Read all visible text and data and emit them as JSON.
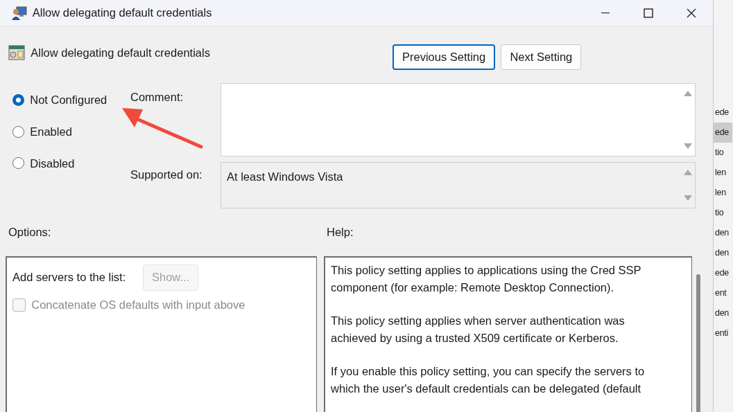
{
  "window": {
    "title": "Allow delegating default credentials"
  },
  "setting": {
    "name": "Allow delegating default credentials"
  },
  "nav_buttons": [
    {
      "label": "Previous Setting",
      "focused": true
    },
    {
      "label": "Next Setting",
      "focused": false
    }
  ],
  "states": [
    {
      "label": "Not Configured",
      "selected": true
    },
    {
      "label": "Enabled",
      "selected": false
    },
    {
      "label": "Disabled",
      "selected": false
    }
  ],
  "comment": {
    "label": "Comment:"
  },
  "supported_on": {
    "label": "Supported on:",
    "value": "At least Windows Vista"
  },
  "options": {
    "label": "Options:",
    "server_list": {
      "label": "Add servers to the list:",
      "button": "Show...",
      "disabled": true
    },
    "concatenate": {
      "label": "Concatenate OS defaults with input above",
      "checked": false,
      "disabled": true
    }
  },
  "help": {
    "label": "Help:",
    "paragraphs": [
      "This policy setting applies to applications using the Cred SSP\ncomponent (for example: Remote Desktop Connection).",
      "This policy setting applies when server authentication was\nachieved by using a trusted X509 certificate or Kerberos.",
      "If you enable this policy setting, you can specify the servers to\nwhich the user's default credentials can be delegated (default"
    ]
  },
  "background_list": [
    {
      "text": "ede",
      "selected": false
    },
    {
      "text": "ede",
      "selected": true
    },
    {
      "text": "tio",
      "selected": false
    },
    {
      "text": "len",
      "selected": false
    },
    {
      "text": "len",
      "selected": false
    },
    {
      "text": "tio",
      "selected": false
    },
    {
      "text": "den",
      "selected": false
    },
    {
      "text": "den",
      "selected": false
    },
    {
      "text": "ede",
      "selected": false
    },
    {
      "text": "ent",
      "selected": false
    },
    {
      "text": "den",
      "selected": false
    },
    {
      "text": "enti",
      "selected": false
    }
  ]
}
